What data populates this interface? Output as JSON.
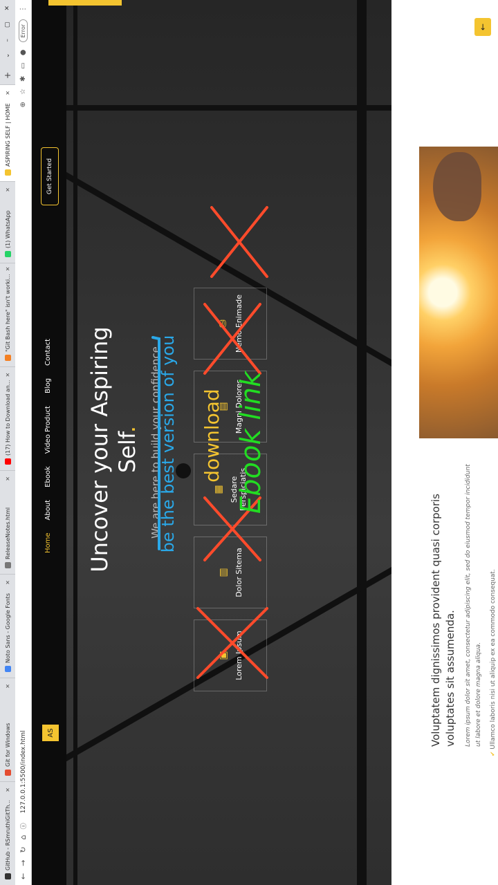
{
  "browser": {
    "tabs": [
      {
        "label": "GitHub - RSmruthiGitTh...",
        "color": "#333333"
      },
      {
        "label": "Git for Windows",
        "color": "#e44c30"
      },
      {
        "label": "Noto Sans - Google Fonts",
        "color": "#4285f4"
      },
      {
        "label": "ReleaseNotes.html",
        "color": "#777777"
      },
      {
        "label": "(17) How to Download an...",
        "color": "#ff0000"
      },
      {
        "label": "\"Git Bash here\" isn't worki...",
        "color": "#f48024"
      },
      {
        "label": "(1) WhatsApp",
        "color": "#25d366"
      },
      {
        "label": "ASPIRING SELF | HOME",
        "color": "#f4c430"
      }
    ],
    "new_tab": "+",
    "url": "127.0.0.1:5500/index.html",
    "error_badge": "Error"
  },
  "site": {
    "logo": "AS",
    "menu": [
      "Home",
      "About",
      "Ebook",
      "Video Product",
      "Blog",
      "Contact"
    ],
    "cta": "Get Started",
    "hero_title_line1": "Uncover your Aspiring",
    "hero_title_line2": "Self",
    "hero_title_dot": ".",
    "hero_subtitle": "We are here to build your confidence",
    "cards": [
      {
        "label": "Lorem Ipsum",
        "icon": "briefcase-icon",
        "glyph": "▣"
      },
      {
        "label": "Dolor Sitema",
        "icon": "chart-icon",
        "glyph": "▥"
      },
      {
        "label": "Sedare Perspiciatis",
        "icon": "calendar-icon",
        "glyph": "▦"
      },
      {
        "label": "Magni Dolores",
        "icon": "podium-icon",
        "glyph": "▤"
      },
      {
        "label": "Nemo Enimade",
        "icon": "database-icon",
        "glyph": "⛁"
      }
    ]
  },
  "annotations": {
    "blue_text": "be the best version of you",
    "yellow_text": "download",
    "green_text": "Ebook link"
  },
  "panel": {
    "title": "Voluptatem dignissimos provident quasi corporis voluptates sit assumenda.",
    "text": "Lorem ipsum dolor sit amet, consectetur adipiscing elit, sed do eiusmod tempor incididunt ut labore et dolore magna aliqua.",
    "list_item": "Ullamco laboris nisi ut aliquip ex ea commodo consequat.",
    "back_glyph": "←"
  },
  "colors": {
    "accent": "#f4c430",
    "annotation_red": "#ff4b2b",
    "annotation_blue": "#2aa8e8",
    "annotation_green": "#22dd22"
  }
}
